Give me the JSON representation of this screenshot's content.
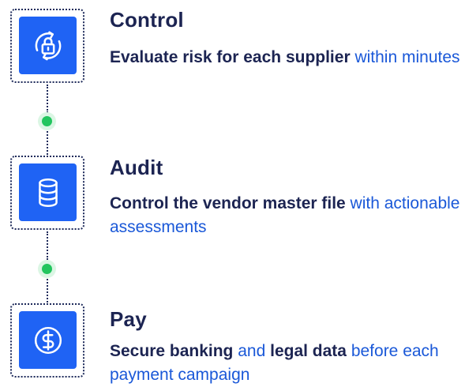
{
  "steps": [
    {
      "title": "Control",
      "icon": "lock-refresh-icon",
      "desc_bold": "Evaluate risk for each supplier",
      "desc_rest": " within minutes"
    },
    {
      "title": "Audit",
      "icon": "database-icon",
      "desc_bold": "Control the vendor master file",
      "desc_rest": " with actionable assessments"
    },
    {
      "title": "Pay",
      "icon": "dollar-coin-icon",
      "desc_bold_1": "Secure banking",
      "desc_mid": " and ",
      "desc_bold_2": "legal data",
      "desc_rest": " before each payment campaign"
    }
  ],
  "colors": {
    "tile": "#1f63f4",
    "title": "#1c2452",
    "highlight": "#1c2452",
    "text": "#1a58d8",
    "dot": "#22c55e",
    "frame": "#1f2b5b"
  }
}
